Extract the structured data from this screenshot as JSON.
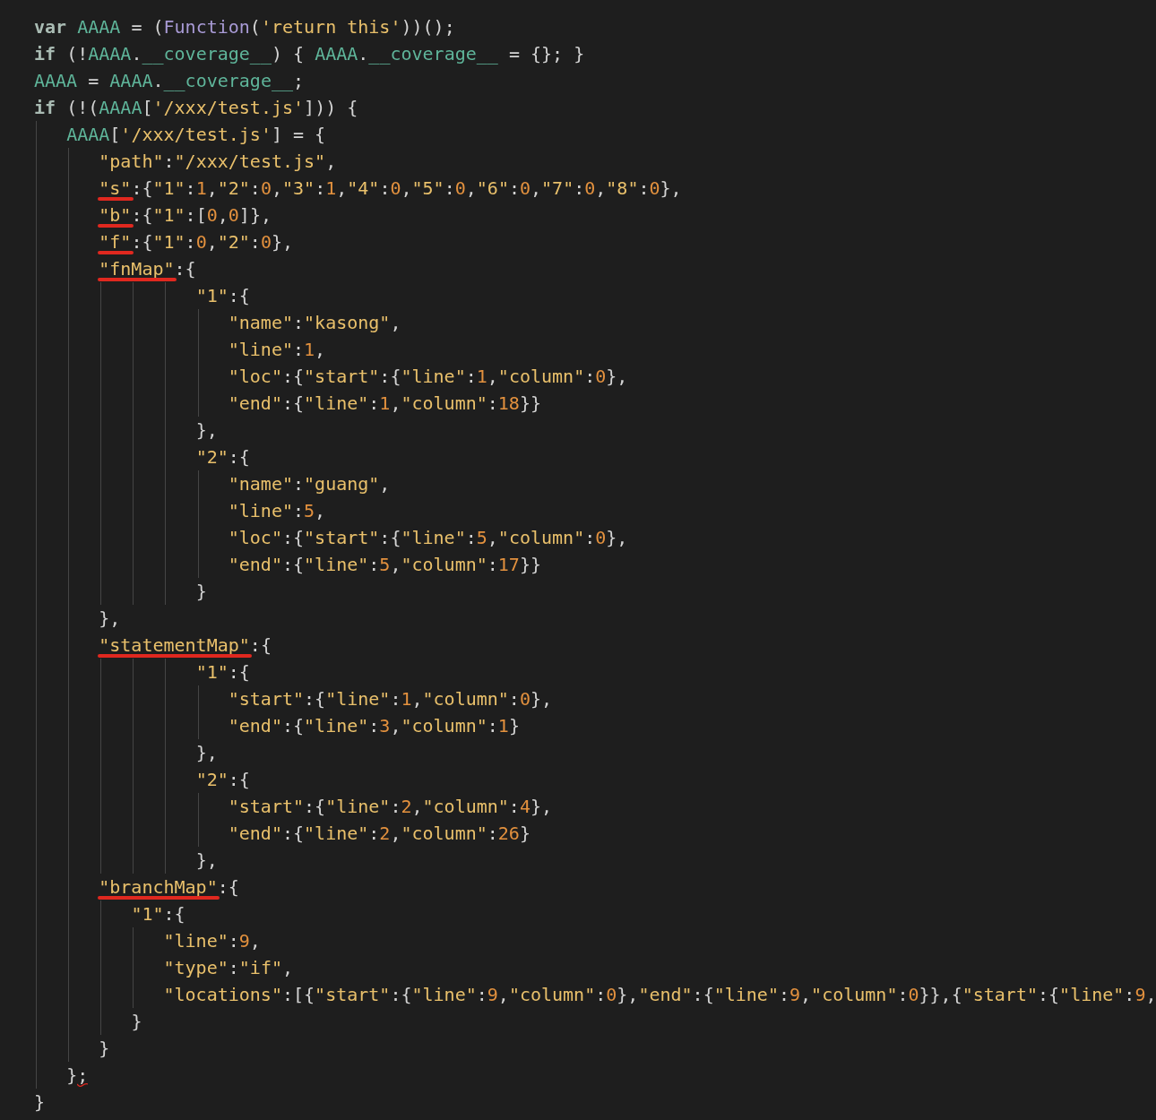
{
  "editor": {
    "lines": [
      {
        "code": "var AAAA = (Function('return this'))();",
        "identifiers": [
          {
            "kind": "keyword"
          },
          {
            "kind": "variable"
          },
          {
            "kind": "function"
          }
        ]
      },
      {
        "code": "if (!AAAA.__coverage__) { AAAA.__coverage__ = {}; }",
        "identifiers": [
          {
            "kind": "keyword"
          },
          {
            "kind": "variable"
          },
          {
            "kind": "variable"
          },
          {
            "kind": "variable"
          },
          {
            "kind": "variable"
          }
        ]
      },
      {
        "code": "AAAA = AAAA.__coverage__;",
        "identifiers": [
          {
            "kind": "variable"
          },
          {
            "kind": "variable"
          },
          {
            "kind": "variable"
          }
        ]
      },
      {
        "code": "if (!(AAAA['/xxx/test.js'])) {",
        "identifiers": [
          {
            "kind": "keyword"
          },
          {
            "kind": "variable"
          }
        ]
      },
      {
        "code": "   AAAA['/xxx/test.js'] = {",
        "identifiers": [
          {
            "kind": "variable"
          }
        ]
      },
      {
        "code": "      \"path\":\"/xxx/test.js\","
      },
      {
        "code": "      \"s\":{\"1\":1,\"2\":0,\"3\":1,\"4\":0,\"5\":0,\"6\":0,\"7\":0,\"8\":0},",
        "underlined": true
      },
      {
        "code": "      \"b\":{\"1\":[0,0]},",
        "underlined": true
      },
      {
        "code": "      \"f\":{\"1\":0,\"2\":0},",
        "underlined": true
      },
      {
        "code": "      \"fnMap\":{",
        "underlined": true
      },
      {
        "code": "               \"1\":{"
      },
      {
        "code": "                  \"name\":\"kasong\","
      },
      {
        "code": "                  \"line\":1,"
      },
      {
        "code": "                  \"loc\":{\"start\":{\"line\":1,\"column\":0},"
      },
      {
        "code": "                  \"end\":{\"line\":1,\"column\":18}}"
      },
      {
        "code": "               },"
      },
      {
        "code": "               \"2\":{"
      },
      {
        "code": "                  \"name\":\"guang\","
      },
      {
        "code": "                  \"line\":5,"
      },
      {
        "code": "                  \"loc\":{\"start\":{\"line\":5,\"column\":0},"
      },
      {
        "code": "                  \"end\":{\"line\":5,\"column\":17}}"
      },
      {
        "code": "               }"
      },
      {
        "code": "      },"
      },
      {
        "code": "      \"statementMap\":{",
        "underlined": true
      },
      {
        "code": "               \"1\":{"
      },
      {
        "code": "                  \"start\":{\"line\":1,\"column\":0},"
      },
      {
        "code": "                  \"end\":{\"line\":3,\"column\":1}"
      },
      {
        "code": "               },"
      },
      {
        "code": "               \"2\":{"
      },
      {
        "code": "                  \"start\":{\"line\":2,\"column\":4},"
      },
      {
        "code": "                  \"end\":{\"line\":2,\"column\":26}"
      },
      {
        "code": "               },"
      },
      {
        "code": "      \"branchMap\":{",
        "underlined": true
      },
      {
        "code": "         \"1\":{"
      },
      {
        "code": "            \"line\":9,"
      },
      {
        "code": "            \"type\":\"if\","
      },
      {
        "code": "            \"locations\":[{\"start\":{\"line\":9,\"column\":0},\"end\":{\"line\":9,\"column\":0}},{\"start\":{\"line\":9,"
      },
      {
        "code": "         }"
      },
      {
        "code": "      }"
      },
      {
        "code": "   };",
        "warning": true
      },
      {
        "code": "}"
      }
    ]
  }
}
